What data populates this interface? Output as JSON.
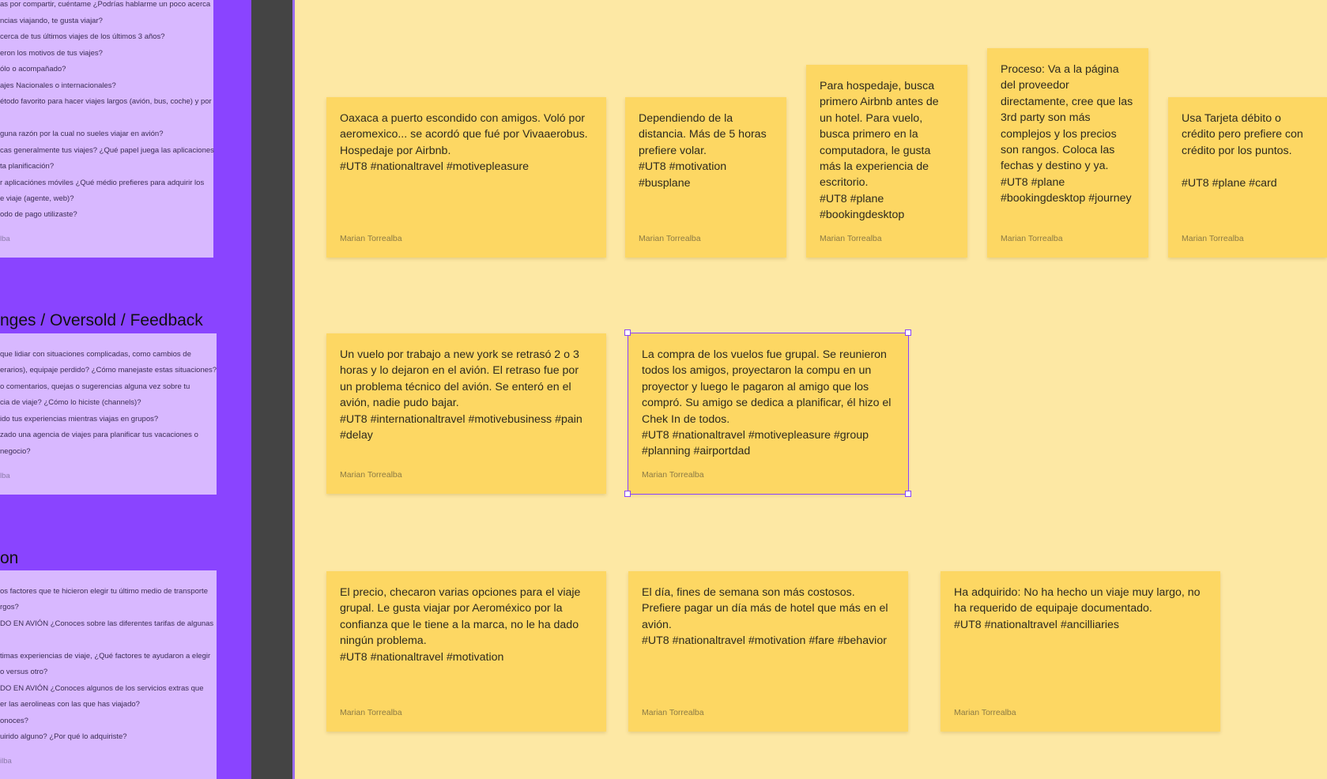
{
  "question_boards": [
    {
      "title": "",
      "lines": [
        "as por compartir, cuéntame ¿Podrías hablarme un poco acerca",
        "ncias viajando, te gusta viajar?",
        "cerca de tus últimos viajes de los últimos 3 años?",
        "eron los motivos de tus viajes?",
        "ólo o acompañado?",
        "ajes Nacionales o internacionales?",
        "étodo favorito para hacer viajes largos (avión, bus, coche) y por",
        "",
        "guna razón por la cual no sueles viajar en avión?",
        "cas generalmente tus viajes? ¿Qué papel juega las aplicaciones",
        "ta planificación?",
        "r aplicaciónes móviles ¿Qué médio prefieres para adquirir los",
        "e viaje (agente, web)?",
        "odo de pago utilizaste?"
      ],
      "author": "lba"
    },
    {
      "title": "nges / Oversold / Feedback",
      "lines": [
        "que lidiar con situaciones complicadas, como cambios de",
        "erarios), equipaje perdido? ¿Cómo manejaste estas situaciones?",
        "o comentarios, quejas o sugerencias alguna vez sobre tu",
        "cia de viaje? ¿Cómo lo hiciste (channels)?",
        "ido tus experiencias mientras viajas en grupos?",
        "zado una agencia de viajes para planificar tus vacaciones o",
        "negocio?"
      ],
      "author": "lba"
    },
    {
      "title": "on",
      "lines": [
        "os factores que te hicieron elegir tu último medio de transporte",
        "rgos?",
        "DO EN AVIÓN ¿Conoces sobre las diferentes tarifas de algunas",
        "",
        "timas experiencias de viaje, ¿Qué factores te ayudaron a elegir",
        "o versus otro?",
        "DO EN AVIÓN ¿Conoces algunos de los servicios extras que",
        "er las aerolineas con las que has viajado?",
        "onoces?",
        "uirido alguno? ¿Por qué lo adquiriste?"
      ],
      "author": "ilba"
    }
  ],
  "stickies": [
    {
      "text": "Oaxaca a puerto escondido con amigos. Voló por aeromexico... se acordó que fué por Vivaaerobus. Hospedaje por Airbnb.\n#UT8 #nationaltravel #motivepleasure",
      "author": "Marian Torrealba"
    },
    {
      "text": "Dependiendo de la distancia. Más de 5 horas prefiere volar.\n#UT8 #motivation #busplane",
      "author": "Marian Torrealba"
    },
    {
      "text": "Para hospedaje, busca primero Airbnb antes de un hotel. Para vuelo, busca primero en la computadora, le gusta más la experiencia de escritorio.\n#UT8 #plane #bookingdesktop",
      "author": "Marian Torrealba"
    },
    {
      "text": "Proceso: Va a la página del proveedor directamente, cree que las 3rd party son más complejos y los precios son rangos. Coloca las fechas y destino y ya.\n#UT8 #plane #bookingdesktop #journey",
      "author": "Marian Torrealba"
    },
    {
      "text": "Usa Tarjeta débito o crédito pero prefiere con crédito por los puntos.\n\n#UT8 #plane #card",
      "author": "Marian Torrealba"
    },
    {
      "text": "Un vuelo por trabajo a new york se retrasó 2 o 3 horas y lo dejaron en el avión. El retraso fue por un problema técnico del avión. Se enteró en el avión, nadie pudo bajar.\n#UT8 #internationaltravel #motivebusiness #pain #delay",
      "author": "Marian Torrealba"
    },
    {
      "text": "La compra de los vuelos fue grupal. Se reunieron todos los amigos, proyectaron la compu en un proyector y luego le pagaron al amigo que los compró. Su amigo se dedica a planificar, él hizo el Chek In de todos.\n#UT8 #nationaltravel #motivepleasure #group #planning #airportdad",
      "author": "Marian Torrealba"
    },
    {
      "text": "El precio, checaron varias opciones para el viaje grupal. Le gusta viajar por Aeroméxico por la confianza que le tiene a la marca, no le ha dado ningún problema.\n#UT8 #nationaltravel #motivation",
      "author": "Marian Torrealba"
    },
    {
      "text": "El día, fines de semana son más costosos. Prefiere pagar un día más de hotel que más en el avión.\n#UT8 #nationaltravel #motivation #fare #behavior",
      "author": "Marian Torrealba"
    },
    {
      "text": "Ha adquirido: No ha hecho un viaje muy largo, no ha requerido de equipaje documentado.\n#UT8 #nationaltravel #ancilliaries",
      "author": "Marian Torrealba"
    }
  ],
  "colors": {
    "canvas": "#fde8a4",
    "sticky": "#fdd763",
    "section_band": "#8a44ff",
    "question_note": "#d8b8ff",
    "selection": "#8a44ff"
  }
}
